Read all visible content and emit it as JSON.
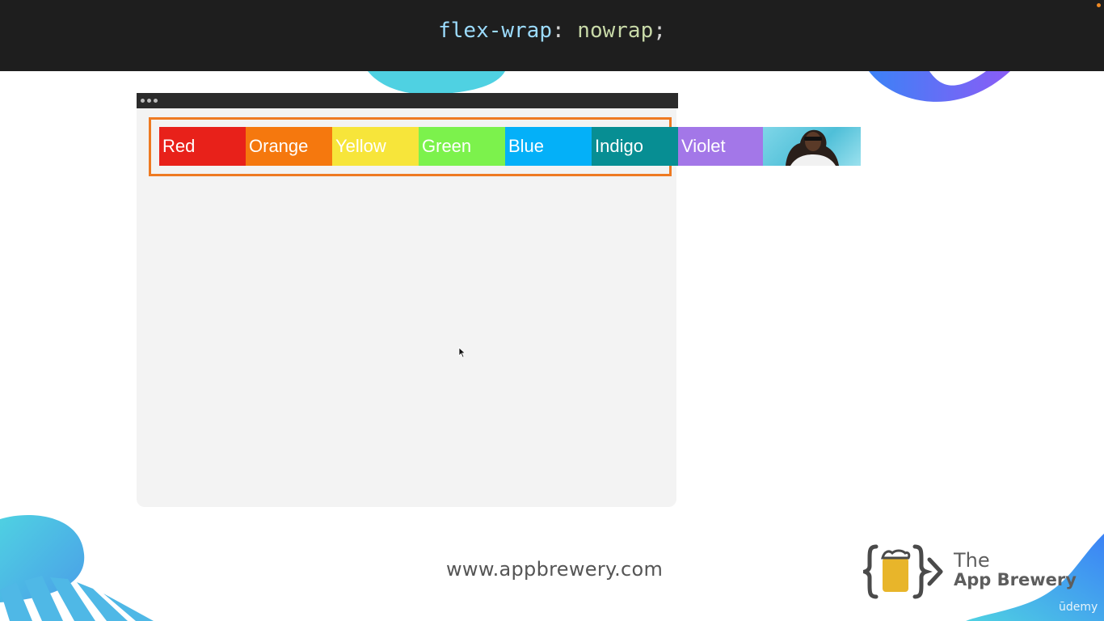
{
  "header": {
    "code_property": "flex-wrap",
    "code_colon": ":",
    "code_value": " nowrap",
    "code_semicolon": ";"
  },
  "flex_items": [
    {
      "label": "Red",
      "color": "#e8211a"
    },
    {
      "label": "Orange",
      "color": "#f5780e"
    },
    {
      "label": "Yellow",
      "color": "#f7e53a"
    },
    {
      "label": "Green",
      "color": "#7cf24c"
    },
    {
      "label": "Blue",
      "color": "#04b0f8"
    },
    {
      "label": "Indigo",
      "color": "#078e93"
    },
    {
      "label": "Violet",
      "color": "#a377e8"
    }
  ],
  "footer": {
    "url": "www.appbrewery.com",
    "logo_line1": "The",
    "logo_line2": "App Brewery",
    "watermark": "ūdemy"
  },
  "colors": {
    "container_border": "#ee7a22",
    "accent_teal": "#4fd1e2",
    "accent_purple": "#8b5cf6",
    "logo_yellow": "#e8b52a"
  }
}
